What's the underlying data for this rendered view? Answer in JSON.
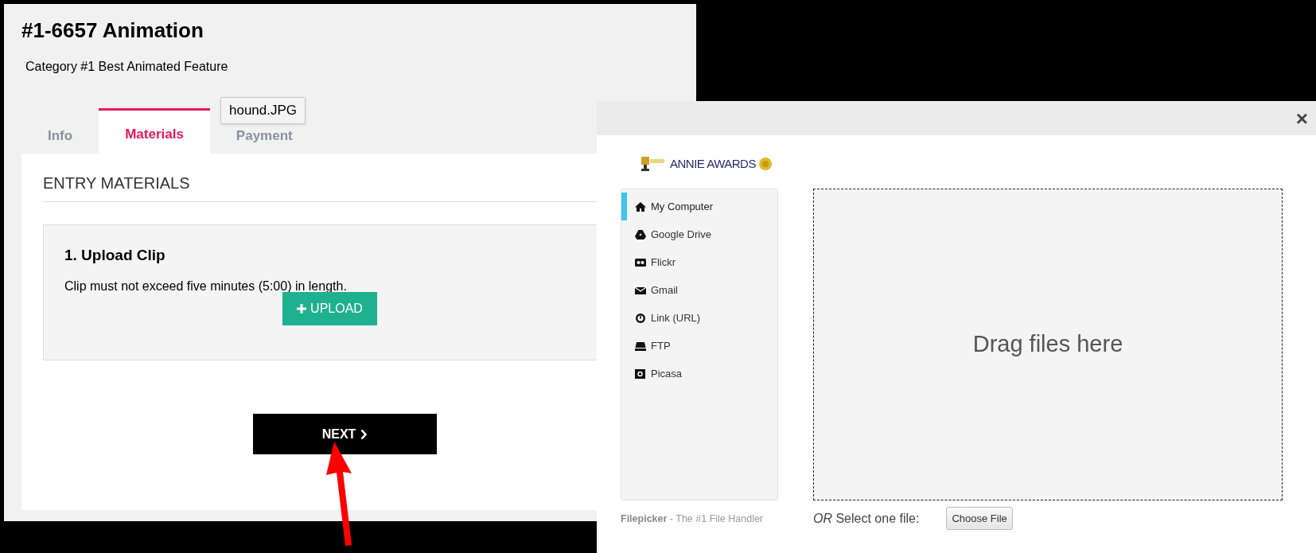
{
  "entry_page": {
    "title": "#1-6657 Animation",
    "category": "Category #1 Best Animated Feature",
    "tabs": [
      {
        "label": "Info",
        "selected": false
      },
      {
        "label": "Materials",
        "selected": true
      },
      {
        "label": "Payment",
        "selected": false
      }
    ],
    "tooltip": "hound.JPG",
    "section_heading": "ENTRY MATERIALS",
    "step": {
      "title": "1. Upload Clip",
      "description": "Clip must not exceed five minutes (5:00) in length.",
      "button": "UPLOAD"
    },
    "next_button": "NEXT"
  },
  "file_picker": {
    "close": "×",
    "logo_text": "ANNIE AWARDS",
    "sources": [
      {
        "kind": "home",
        "label": "My Computer",
        "selected": true
      },
      {
        "kind": "drive",
        "label": "Google Drive",
        "selected": false
      },
      {
        "kind": "flickr",
        "label": "Flickr",
        "selected": false
      },
      {
        "kind": "mail",
        "label": "Gmail",
        "selected": false
      },
      {
        "kind": "link",
        "label": "Link (URL)",
        "selected": false
      },
      {
        "kind": "ftp",
        "label": "FTP",
        "selected": false
      },
      {
        "kind": "picasa",
        "label": "Picasa",
        "selected": false
      }
    ],
    "drop_zone": "Drag files here",
    "footer": "**Filepicker** - The #1 File Handler",
    "select_label": "*OR* Select one file:",
    "choose_button": "Choose File"
  }
}
